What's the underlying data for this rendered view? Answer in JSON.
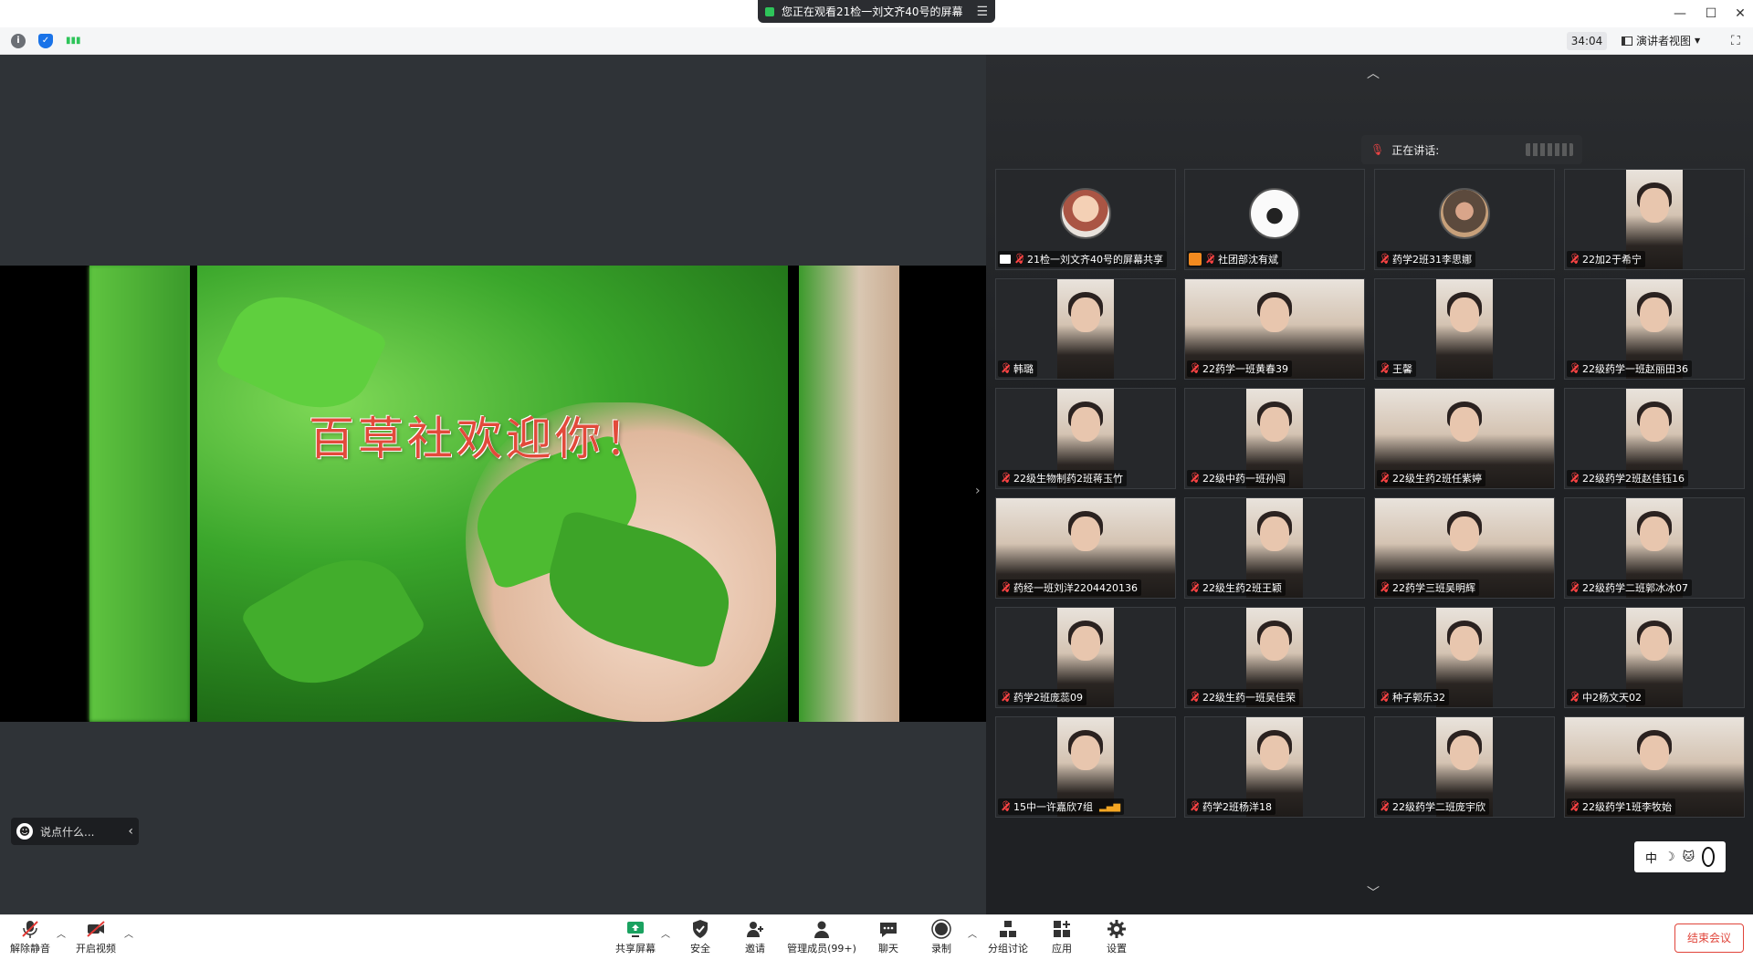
{
  "banner": {
    "text": "您正在观看21检一刘文齐40号的屏幕"
  },
  "window_controls": [
    "—",
    "☐",
    "✕"
  ],
  "status_strip": {
    "timer": "34:04",
    "view_mode": "演讲者视图"
  },
  "slide": {
    "title": "百草社欢迎你！"
  },
  "chat": {
    "placeholder": "说点什么..."
  },
  "speaking": {
    "label": "正在讲话:"
  },
  "participants": [
    {
      "name": "21检一刘文齐40号的屏幕共享",
      "kind": "avatar-cartoon",
      "badge": "share"
    },
    {
      "name": "社团部沈有斌",
      "kind": "avatar-cat",
      "badge": "person"
    },
    {
      "name": "药学2班31李思娜",
      "kind": "avatar-photo"
    },
    {
      "name": "22加2于希宁",
      "kind": "face"
    },
    {
      "name": "韩璐",
      "kind": "face"
    },
    {
      "name": "22药学一班黄春39",
      "kind": "wide"
    },
    {
      "name": "王馨",
      "kind": "face"
    },
    {
      "name": "22级药学一班赵丽田36",
      "kind": "face"
    },
    {
      "name": "22级生物制药2班蒋玉竹",
      "kind": "face"
    },
    {
      "name": "22级中药一班孙闯",
      "kind": "face"
    },
    {
      "name": "22级生药2班任紫婷",
      "kind": "wide"
    },
    {
      "name": "22级药学2班赵佳钰16",
      "kind": "face"
    },
    {
      "name": "药经一班刘洋2204420136",
      "kind": "wide"
    },
    {
      "name": "22级生药2班王颖",
      "kind": "face"
    },
    {
      "name": "22药学三班吴明辉",
      "kind": "wide"
    },
    {
      "name": "22级药学二班郭冰冰07",
      "kind": "face"
    },
    {
      "name": "药学2班庞蕊09",
      "kind": "face"
    },
    {
      "name": "22级生药一班吴佳荣",
      "kind": "face"
    },
    {
      "name": "种子郭乐32",
      "kind": "face"
    },
    {
      "name": "中2杨文天02",
      "kind": "face"
    },
    {
      "name": "15中一许嘉欣7组",
      "kind": "face",
      "signal": true
    },
    {
      "name": "药学2班杨洋18",
      "kind": "face"
    },
    {
      "name": "22级药学二班庞宇欣",
      "kind": "face"
    },
    {
      "name": "22级药学1班李牧始",
      "kind": "wide"
    }
  ],
  "ime": {
    "lang": "中",
    "moon": "☽",
    "cat": "🐱"
  },
  "toolbar": {
    "unmute": "解除静音",
    "start_video": "开启视频",
    "share_screen": "共享屏幕",
    "security": "安全",
    "invite": "邀请",
    "manage": "管理成员(99+)",
    "chat": "聊天",
    "record": "录制",
    "breakout": "分组讨论",
    "apps": "应用",
    "settings": "设置",
    "end_meeting": "结束会议"
  },
  "colors": {
    "accent_green": "#2ec45a",
    "end_red": "#e0443a",
    "mute_red": "#f44"
  }
}
